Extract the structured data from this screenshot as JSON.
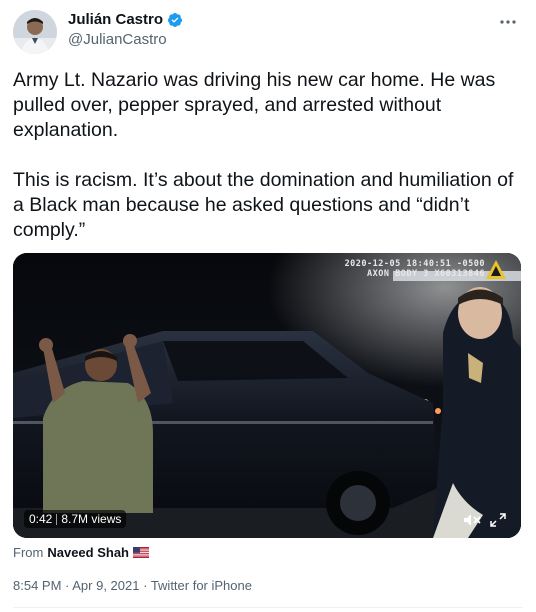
{
  "author": {
    "display_name": "Julián Castro",
    "handle": "@JulianCastro",
    "verified": true
  },
  "tweet": {
    "paragraphs": [
      "Army Lt. Nazario was driving his new car home. He was pulled over, pepper sprayed, and arrested without explanation.",
      "This is racism. It’s about the domination and humiliation of a Black man because he asked questions and “didn’t comply.”"
    ]
  },
  "media": {
    "timestamp_overlay": "2020-12-05 18:40:51 -0500",
    "camera_overlay": "AXON BODY 3 X60313846",
    "duration": "0:42",
    "views": "8.7M views"
  },
  "attribution": {
    "from_label": "From",
    "source_user": "Naveed Shah",
    "flag": "us-flag-icon"
  },
  "meta": {
    "time": "8:54 PM",
    "separator": " · ",
    "date": "Apr 9, 2021",
    "client": "Twitter for iPhone"
  },
  "colors": {
    "verified_blue": "#1d9bf0",
    "secondary_text": "#536471",
    "primary_text": "#0f1419"
  },
  "icons": [
    "more-icon",
    "verified-icon",
    "axon-badge-icon",
    "volume-icon",
    "fullscreen-icon",
    "us-flag-icon"
  ]
}
